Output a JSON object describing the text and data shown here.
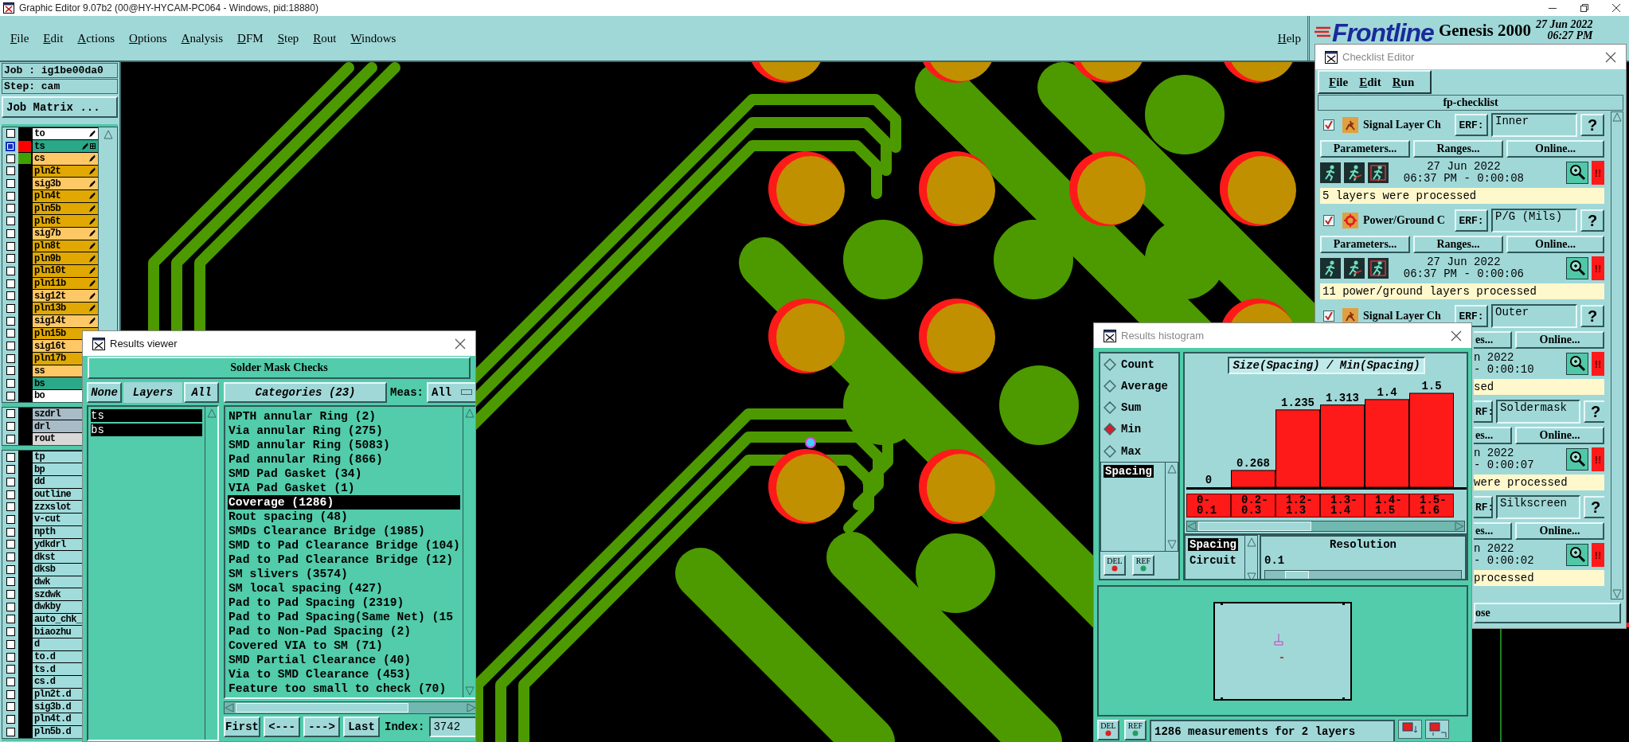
{
  "window": {
    "title": "Graphic Editor 9.07b2 (00@HY-HYCAM-PC064 - Windows, pid:18880)"
  },
  "menu": [
    "File",
    "Edit",
    "Actions",
    "Options",
    "Analysis",
    "DFM",
    "Step",
    "Rout",
    "Windows"
  ],
  "help_menu": "Help",
  "brand": {
    "logo": "Frontline",
    "product": "Genesis 2000",
    "date": "27 Jun 2022",
    "time": "06:27 PM"
  },
  "job": {
    "job": "Job : ig1be00da0",
    "step": "Step: cam",
    "matrix": "Job Matrix ..."
  },
  "layer_groups": [
    [
      {
        "name": "to",
        "color": "#ffffff",
        "selected": false,
        "pen": true
      },
      {
        "name": "ts",
        "color": "#2aa888",
        "swatch": {
          "color": "#ff0000"
        },
        "selected": true,
        "pen": true,
        "snap": true
      },
      {
        "name": "cs",
        "color": "#ffc866",
        "swatch": {
          "color": "#40a000"
        },
        "selected": false,
        "pen": true
      },
      {
        "name": "pln2t",
        "color": "#e0a800",
        "selected": false,
        "pen": true
      },
      {
        "name": "sig3b",
        "color": "#ffc866",
        "selected": false,
        "pen": true
      },
      {
        "name": "pln4t",
        "color": "#e0a800",
        "selected": false,
        "pen": true
      },
      {
        "name": "pln5b",
        "color": "#e0a800",
        "selected": false,
        "pen": true
      },
      {
        "name": "pln6t",
        "color": "#e0a800",
        "selected": false,
        "pen": true
      },
      {
        "name": "sig7b",
        "color": "#ffc866",
        "selected": false,
        "pen": true
      },
      {
        "name": "pln8t",
        "color": "#e0a800",
        "selected": false,
        "pen": true
      },
      {
        "name": "pln9b",
        "color": "#e0a800",
        "selected": false,
        "pen": true
      },
      {
        "name": "pln10t",
        "color": "#e0a800",
        "selected": false,
        "pen": true
      },
      {
        "name": "pln11b",
        "color": "#e0a800",
        "selected": false,
        "pen": true
      },
      {
        "name": "sig12t",
        "color": "#ffc866",
        "selected": false,
        "pen": true
      },
      {
        "name": "pln13b",
        "color": "#e0a800",
        "selected": false,
        "pen": true
      },
      {
        "name": "sig14t",
        "color": "#ffc866",
        "selected": false,
        "pen": true
      },
      {
        "name": "pln15b",
        "color": "#e0a800",
        "selected": false,
        "pen": false
      },
      {
        "name": "sig16t",
        "color": "#ffc866",
        "selected": false,
        "pen": false
      },
      {
        "name": "pln17b",
        "color": "#e0a800",
        "selected": false,
        "pen": false
      },
      {
        "name": "ss",
        "color": "#ffc866",
        "selected": false,
        "pen": false
      },
      {
        "name": "bs",
        "color": "#2aa888",
        "selected": false,
        "pen": false
      },
      {
        "name": "bo",
        "color": "#ffffff",
        "selected": false,
        "pen": false
      }
    ],
    [
      {
        "name": "szdrl",
        "color": "#a8bcc8",
        "selected": false
      },
      {
        "name": "drl",
        "color": "#a8bcc8",
        "selected": false
      },
      {
        "name": "rout",
        "color": "#d8d8d8",
        "selected": false
      }
    ],
    [
      {
        "name": "tp",
        "color": "#a0dcdc",
        "selected": false
      },
      {
        "name": "bp",
        "color": "#a0dcdc",
        "selected": false
      },
      {
        "name": "dd",
        "color": "#a0dcdc",
        "selected": false
      },
      {
        "name": "outline",
        "color": "#a0dcdc",
        "selected": false
      },
      {
        "name": "zzxslot",
        "color": "#a0dcdc",
        "selected": false
      },
      {
        "name": "v-cut",
        "color": "#a0dcdc",
        "selected": false
      },
      {
        "name": "npth",
        "color": "#a0dcdc",
        "selected": false
      },
      {
        "name": "ydkdrl",
        "color": "#a0dcdc",
        "selected": false
      },
      {
        "name": "dkst",
        "color": "#a0dcdc",
        "selected": false
      },
      {
        "name": "dksb",
        "color": "#a0dcdc",
        "selected": false
      },
      {
        "name": "dwk",
        "color": "#a0dcdc",
        "selected": false
      },
      {
        "name": "szdwk",
        "color": "#a0dcdc",
        "selected": false
      },
      {
        "name": "dwkby",
        "color": "#a0dcdc",
        "selected": false
      },
      {
        "name": "auto_chk_",
        "color": "#a0dcdc",
        "selected": false
      },
      {
        "name": "biaozhu",
        "color": "#a0dcdc",
        "selected": false
      },
      {
        "name": "d",
        "color": "#a0dcdc",
        "selected": false
      },
      {
        "name": "to.d",
        "color": "#a0dcdc",
        "selected": false
      },
      {
        "name": "ts.d",
        "color": "#a0dcdc",
        "selected": false
      },
      {
        "name": "cs.d",
        "color": "#a0dcdc",
        "selected": false
      },
      {
        "name": "pln2t.d",
        "color": "#a0dcdc",
        "selected": false
      },
      {
        "name": "sig3b.d",
        "color": "#a0dcdc",
        "selected": false
      },
      {
        "name": "pln4t.d",
        "color": "#a0dcdc",
        "selected": false
      },
      {
        "name": "pln5b.d",
        "color": "#a0dcdc",
        "selected": false
      }
    ]
  ],
  "results_viewer": {
    "title": "Results viewer",
    "header": "Solder Mask Checks",
    "none_button": "None",
    "layers_label": "Layers",
    "all_button": "All",
    "layers": [
      {
        "name": "ts",
        "selected": true
      },
      {
        "name": "bs",
        "selected": true
      }
    ],
    "categories_button": "Categories (23)",
    "meas_label": "Meas:",
    "meas_value": "All",
    "categories": [
      {
        "label": "NPTH annular Ring (2)",
        "selected": false
      },
      {
        "label": "Via annular Ring (275)",
        "selected": false
      },
      {
        "label": "SMD annular Ring (5083)",
        "selected": false
      },
      {
        "label": "Pad annular Ring (866)",
        "selected": false
      },
      {
        "label": "SMD Pad Gasket (34)",
        "selected": false
      },
      {
        "label": "VIA Pad Gasket (1)",
        "selected": false
      },
      {
        "label": "Coverage (1286)",
        "selected": true
      },
      {
        "label": "Rout spacing (48)",
        "selected": false
      },
      {
        "label": "SMDs Clearance Bridge (1985)",
        "selected": false
      },
      {
        "label": "SMD to Pad Clearance Bridge (104)",
        "selected": false
      },
      {
        "label": "Pad to Pad Clearance Bridge (12)",
        "selected": false
      },
      {
        "label": "SM slivers (3574)",
        "selected": false
      },
      {
        "label": "SM local spacing (427)",
        "selected": false
      },
      {
        "label": "Pad to Pad Spacing (2319)",
        "selected": false
      },
      {
        "label": "Pad to Pad Spacing(Same Net) (15",
        "selected": false
      },
      {
        "label": "Pad to Non-Pad Spacing (2)",
        "selected": false
      },
      {
        "label": "Covered VIA to SM (71)",
        "selected": false
      },
      {
        "label": "SMD Partial Clearance (40)",
        "selected": false
      },
      {
        "label": "Via to SMD Clearance (453)",
        "selected": false
      },
      {
        "label": "Feature too small to check (70)",
        "selected": false
      }
    ],
    "nav": [
      "First",
      "<---",
      "--->",
      "Last"
    ],
    "index_label": "Index:",
    "index_value": "3742"
  },
  "histogram": {
    "title": "Results histogram",
    "modes": [
      {
        "label": "Count",
        "selected": false
      },
      {
        "label": "Average",
        "selected": false
      },
      {
        "label": "Sum",
        "selected": false
      },
      {
        "label": "Min",
        "selected": true
      },
      {
        "label": "Max",
        "selected": false
      }
    ],
    "fields": [
      {
        "label": "Spacing",
        "selected": true
      }
    ],
    "panel_buttons": [
      "DEL",
      "REF"
    ],
    "chart_data": {
      "type": "bar",
      "title": "Size(Spacing) / Min(Spacing)",
      "categories": [
        "0-0.1",
        "0.2-0.3",
        "1.2-1.3",
        "1.3-1.4",
        "1.4-1.5",
        "1.5-1.6"
      ],
      "values": [
        0,
        0.268,
        1.235,
        1.313,
        1.4,
        1.5
      ],
      "ylim": [
        0,
        1.5
      ],
      "data_labels": true
    },
    "group_fields": [
      {
        "label": "Spacing",
        "selected": true
      },
      {
        "label": "Circuit",
        "selected": false
      }
    ],
    "resolution_label": "Resolution",
    "resolution_value": "0.1",
    "resolution_slider": {
      "level": 0.1
    },
    "bottom_buttons": [
      "DEL",
      "REF"
    ],
    "status": "1286 measurements for 2 layers"
  },
  "checklist": {
    "title": "Checklist Editor",
    "menu": [
      "File",
      "Edit",
      "Run"
    ],
    "name": "fp-checklist",
    "entries": [
      {
        "kind": "signal",
        "checked": true,
        "name": "Signal Layer Ch",
        "erf": "ERF:",
        "field": "Inner",
        "help": "?",
        "buttons": [
          "Parameters...",
          "Ranges...",
          "Online..."
        ],
        "date": "27 Jun 2022",
        "time": "06:37 PM - 0:00:08",
        "alert": "!!",
        "status": "5 layers were processed"
      },
      {
        "kind": "power",
        "checked": true,
        "name": "Power/Ground C",
        "erf": "ERF:",
        "field": "P/G (Mils)",
        "help": "?",
        "buttons": [
          "Parameters...",
          "Ranges...",
          "Online..."
        ],
        "date": "27 Jun 2022",
        "time": "06:37 PM - 0:00:06",
        "alert": "!!",
        "status": "11 power/ground layers processed"
      },
      {
        "kind": "signal",
        "checked": true,
        "name": "Signal Layer Ch",
        "erf": "ERF:",
        "field": "Outer",
        "help": "?",
        "buttons": [
          "es...",
          "Online..."
        ],
        "date": "n 2022",
        "time": "- 0:00:10",
        "alert": "!!",
        "status": "sed"
      },
      {
        "erf": "RF:",
        "field": "Soldermask",
        "help": "?",
        "buttons": [
          "es...",
          "Online..."
        ],
        "date": "n 2022",
        "time": "- 0:00:07",
        "alert": "!!",
        "status": "were processed"
      },
      {
        "erf": "RF:",
        "field": "Silkscreen",
        "help": "?",
        "buttons": [
          "es...",
          "Online..."
        ],
        "date": "n 2022",
        "time": "- 0:00:02",
        "alert": "!!",
        "status": "processed"
      }
    ],
    "close": "ose"
  }
}
